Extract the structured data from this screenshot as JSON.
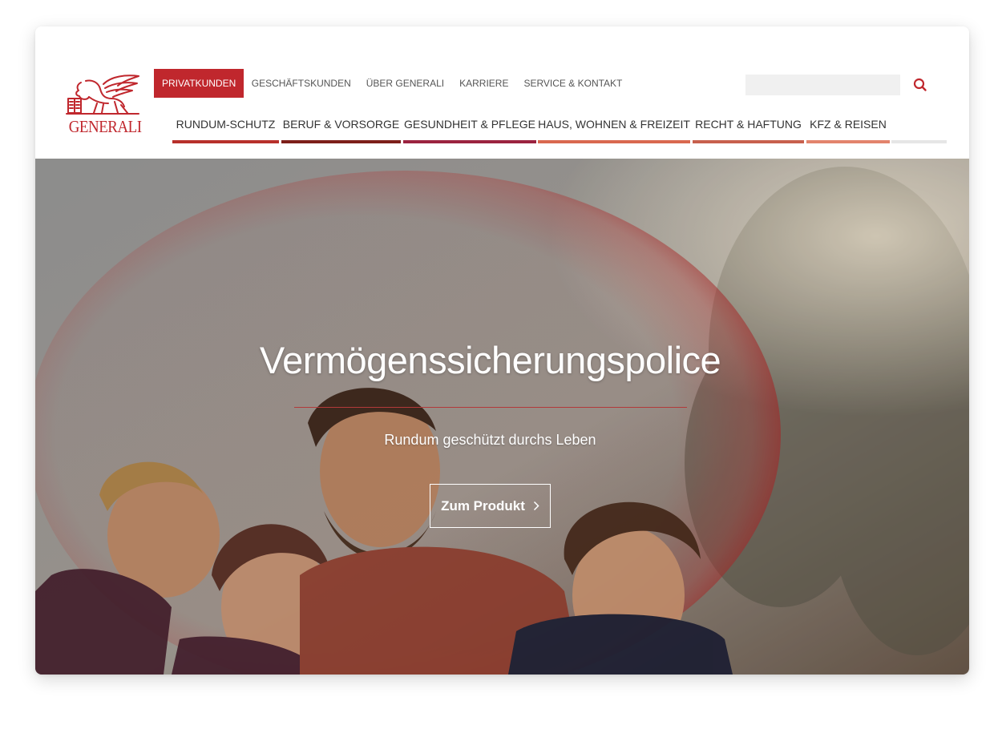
{
  "brand": {
    "name": "GENERALI",
    "color": "#c0272d",
    "logo_icon": "winged-lion-icon"
  },
  "top_nav": [
    {
      "label": "PRIVATKUNDEN",
      "active": true
    },
    {
      "label": "GESCHÄFTSKUNDEN",
      "active": false
    },
    {
      "label": "ÜBER GENERALI",
      "active": false
    },
    {
      "label": "KARRIERE",
      "active": false
    },
    {
      "label": "SERVICE & KONTAKT",
      "active": false
    }
  ],
  "search": {
    "placeholder": "",
    "icon": "search-icon"
  },
  "main_nav": [
    {
      "label": "RUNDUM-SCHUTZ",
      "color": "#b7302b"
    },
    {
      "label": "BERUF & VORSORGE",
      "color": "#7d1f1a"
    },
    {
      "label": "GESUNDHEIT & PFLEGE",
      "color": "#9b2340"
    },
    {
      "label": "HAUS, WOHNEN & FREIZEIT",
      "color": "#d9694f"
    },
    {
      "label": "RECHT & HAFTUNG",
      "color": "#c7604d"
    },
    {
      "label": "KFZ & REISEN",
      "color": "#e3846d"
    }
  ],
  "hero": {
    "title": "Vermögenssicherungspolice",
    "subtitle": "Rundum geschützt durchs Leben",
    "cta_label": "Zum Produkt",
    "cta_icon": "chevron-right-icon"
  }
}
